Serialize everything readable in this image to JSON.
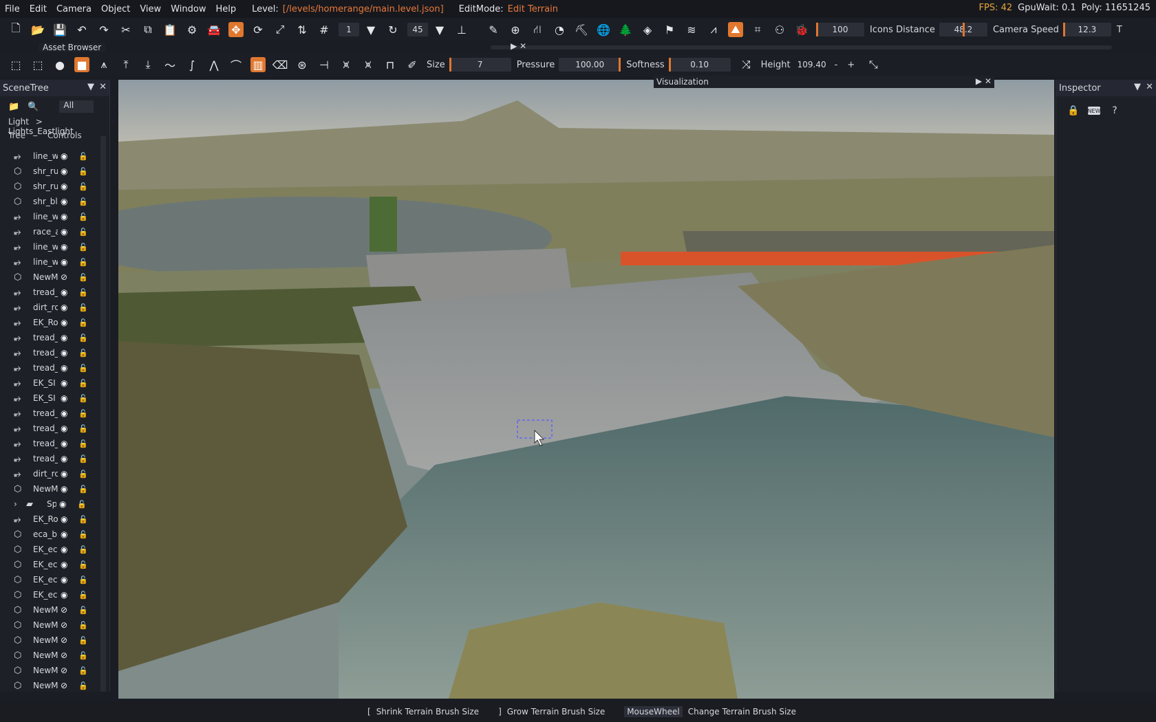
{
  "menubar": {
    "items": [
      "File",
      "Edit",
      "Camera",
      "Object",
      "View",
      "Window",
      "Help"
    ],
    "level_label": "Level:",
    "level_path": "[/levels/homerange/main.level.json]",
    "editmode_label": "EditMode:",
    "editmode_value": "Edit Terrain",
    "fps": "FPS: 42",
    "gpuwait": "GpuWait: 0.1",
    "poly": "Poly: 11651245"
  },
  "toolbar1": {
    "snap_value": "1",
    "angle_value": "45",
    "icon_size": "100",
    "icons_distance_label": "Icons Distance",
    "icons_distance": "48.2",
    "camera_speed_label": "Camera Speed",
    "camera_speed": "12.3",
    "trailing": "T"
  },
  "asset_browser": {
    "title": "Asset Browser"
  },
  "toolbar2": {
    "size_label": "Size",
    "size": "7",
    "pressure_label": "Pressure",
    "pressure": "100.00",
    "softness_label": "Softness",
    "softness": "0.10",
    "height_label": "Height",
    "height": "109.40",
    "minus": "-",
    "plus": "+"
  },
  "scenetree": {
    "title": "SceneTree",
    "filter": "All",
    "breadcrumb_root": "Light",
    "breadcrumb_sep": ">",
    "breadcrumb_leaf": "Lights_Eastlight",
    "col_tree": "Tree",
    "col_controls": "Controls",
    "rows": [
      {
        "name": "line_w",
        "type": "road",
        "hidden": false
      },
      {
        "name": "shr_ru",
        "type": "mesh",
        "hidden": false
      },
      {
        "name": "shr_ru",
        "type": "mesh",
        "hidden": false
      },
      {
        "name": "shr_bl",
        "type": "mesh",
        "hidden": false
      },
      {
        "name": "line_w",
        "type": "road",
        "hidden": false
      },
      {
        "name": "race_a",
        "type": "road",
        "hidden": false
      },
      {
        "name": "line_w",
        "type": "road",
        "hidden": false
      },
      {
        "name": "line_w",
        "type": "road",
        "hidden": false
      },
      {
        "name": "NewM",
        "type": "mesh",
        "hidden": true
      },
      {
        "name": "tread_",
        "type": "road",
        "hidden": false
      },
      {
        "name": "dirt_rc",
        "type": "road",
        "hidden": false
      },
      {
        "name": "EK_Ro",
        "type": "road",
        "hidden": false
      },
      {
        "name": "tread_",
        "type": "road",
        "hidden": false
      },
      {
        "name": "tread_",
        "type": "road",
        "hidden": false
      },
      {
        "name": "tread_",
        "type": "road",
        "hidden": false
      },
      {
        "name": "EK_SI",
        "type": "road",
        "hidden": false
      },
      {
        "name": "EK_SI",
        "type": "road",
        "hidden": false
      },
      {
        "name": "tread_",
        "type": "road",
        "hidden": false
      },
      {
        "name": "tread_",
        "type": "road",
        "hidden": false
      },
      {
        "name": "tread_",
        "type": "road",
        "hidden": false
      },
      {
        "name": "tread_",
        "type": "road",
        "hidden": false
      },
      {
        "name": "dirt_rc",
        "type": "road",
        "hidden": false
      },
      {
        "name": "NewM",
        "type": "mesh",
        "hidden": false
      },
      {
        "name": "Sp",
        "type": "folder",
        "hidden": false
      },
      {
        "name": "EK_Ro",
        "type": "road",
        "hidden": false
      },
      {
        "name": "eca_bl",
        "type": "mesh",
        "hidden": false
      },
      {
        "name": "EK_eca",
        "type": "mesh",
        "hidden": false
      },
      {
        "name": "EK_eca",
        "type": "mesh",
        "hidden": false
      },
      {
        "name": "EK_eca",
        "type": "mesh",
        "hidden": false
      },
      {
        "name": "EK_eca",
        "type": "mesh",
        "hidden": false
      },
      {
        "name": "NewM",
        "type": "mesh",
        "hidden": true
      },
      {
        "name": "NewM",
        "type": "mesh",
        "hidden": true
      },
      {
        "name": "NewM",
        "type": "mesh",
        "hidden": true
      },
      {
        "name": "NewM",
        "type": "mesh",
        "hidden": true
      },
      {
        "name": "NewM",
        "type": "mesh",
        "hidden": true
      },
      {
        "name": "NewM",
        "type": "mesh",
        "hidden": true
      }
    ]
  },
  "visualization": {
    "title": "Visualization"
  },
  "inspector": {
    "title": "Inspector",
    "new_badge": "NEW"
  },
  "statusbar": {
    "items": [
      {
        "key": "[",
        "value": "Shrink Terrain Brush Size"
      },
      {
        "key": "]",
        "value": "Grow Terrain Brush Size"
      },
      {
        "key": "MouseWheel",
        "value": "Change Terrain Brush Size"
      }
    ]
  },
  "colors": {
    "accent": "#e0772f",
    "panel": "#1e2027",
    "menu": "#16181e"
  }
}
